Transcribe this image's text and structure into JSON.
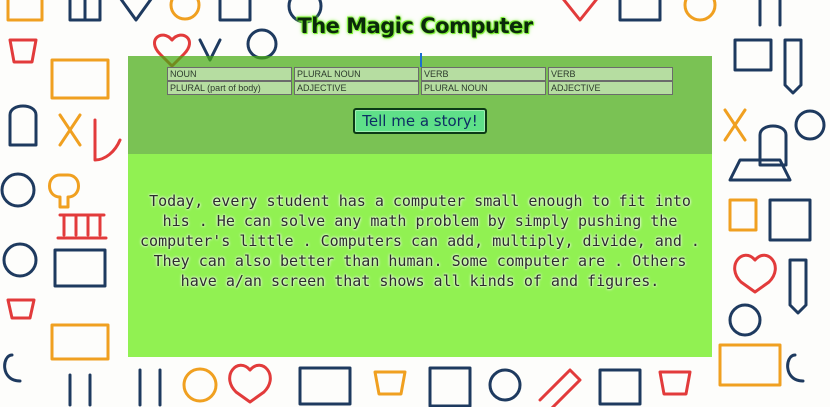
{
  "page": {
    "title": "The Magic Computer"
  },
  "form": {
    "fields": [
      {
        "placeholder": "NOUN"
      },
      {
        "placeholder": "PLURAL NOUN"
      },
      {
        "placeholder": "VERB"
      },
      {
        "placeholder": "VERB"
      },
      {
        "placeholder": "PLURAL (part of body)"
      },
      {
        "placeholder": "ADJECTIVE"
      },
      {
        "placeholder": "PLURAL NOUN"
      },
      {
        "placeholder": "ADJECTIVE"
      }
    ],
    "button_label": "Tell me a story!"
  },
  "story": {
    "text": "Today, every student has a computer small enough to fit into his . He can solve any math problem by simply pushing the computer's little . Computers can add, multiply, divide, and . They can also better than human. Some computer are . Others have a/an screen that shows all kinds of and figures."
  },
  "colors": {
    "panel_top": "#46aa14",
    "panel_bottom": "#76ee28",
    "button": "#5fe089"
  }
}
